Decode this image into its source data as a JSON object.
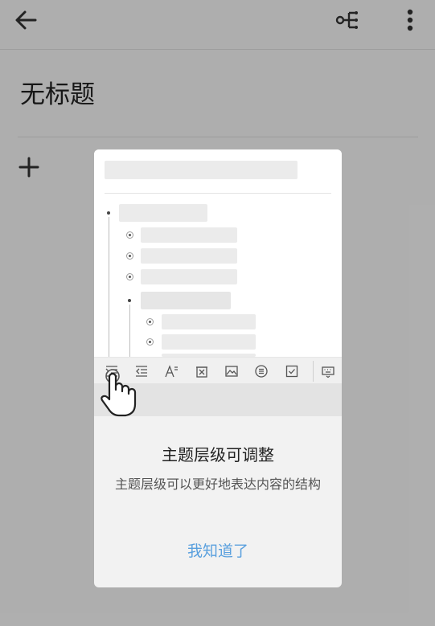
{
  "page": {
    "title": "无标题"
  },
  "toolbar_icons": [
    "indent-icon",
    "outdent-icon",
    "text-style-icon",
    "delete-node-icon",
    "image-icon",
    "list-icon",
    "checkbox-icon",
    "keyboard-icon"
  ],
  "dialog": {
    "title": "主题层级可调整",
    "description": "主题层级可以更好地表达内容的结构",
    "confirm_label": "我知道了"
  },
  "colors": {
    "accent": "#5aa0de",
    "overlay": "rgba(0,0,0,0.30)"
  }
}
